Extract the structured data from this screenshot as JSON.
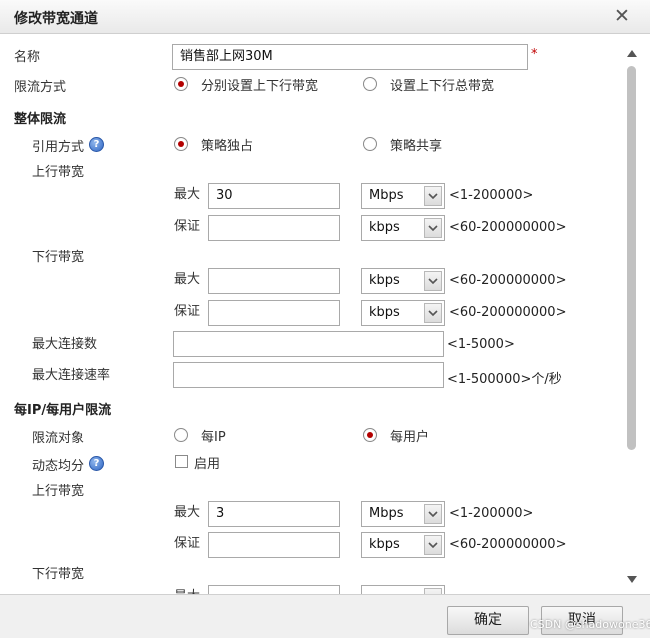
{
  "dialog": {
    "title": "修改带宽通道",
    "close_symbol": "✕"
  },
  "form": {
    "name_label": "名称",
    "name_value": "销售部上网30M",
    "required_mark": "*",
    "limit_mode_label": "限流方式",
    "limit_mode_options": [
      "分别设置上下行带宽",
      "设置上下行总带宽"
    ],
    "limit_mode_selected": 0
  },
  "overall": {
    "section_title": "整体限流",
    "ref_mode_label": "引用方式",
    "help_symbol": "?",
    "ref_mode_options": [
      "策略独占",
      "策略共享"
    ],
    "ref_mode_selected": 0,
    "up_label": "上行带宽",
    "max_label": "最大",
    "guarantee_label": "保证",
    "up_max_value": "30",
    "up_max_unit": "Mbps",
    "up_max_range": "<1-200000>",
    "up_guarantee_value": "",
    "up_guarantee_unit": "kbps",
    "up_guarantee_range": "<60-200000000>",
    "down_label": "下行带宽",
    "down_max_value": "",
    "down_max_unit": "kbps",
    "down_max_range": "<60-200000000>",
    "down_guarantee_value": "",
    "down_guarantee_unit": "kbps",
    "down_guarantee_range": "<60-200000000>",
    "max_conn_label": "最大连接数",
    "max_conn_value": "",
    "max_conn_range": "<1-5000>",
    "max_conn_rate_label": "最大连接速率",
    "max_conn_rate_value": "",
    "max_conn_rate_range": "<1-500000>个/秒"
  },
  "per_user": {
    "section_title": "每IP/每用户限流",
    "target_label": "限流对象",
    "target_options": [
      "每IP",
      "每用户"
    ],
    "target_selected": 1,
    "dynamic_label": "动态均分",
    "help_symbol": "?",
    "enable_label": "启用",
    "enable_checked": false,
    "up_label": "上行带宽",
    "max_label": "最大",
    "guarantee_label": "保证",
    "up_max_value": "3",
    "up_max_unit": "Mbps",
    "up_max_range": "<1-200000>",
    "up_guarantee_value": "",
    "up_guarantee_unit": "kbps",
    "up_guarantee_range": "<60-200000000>",
    "down_label": "下行带宽",
    "down_max_label_partial": "最大"
  },
  "footer": {
    "ok_label": "确定",
    "cancel_label": "取消"
  },
  "watermark": "CSDN @shadowone360",
  "icons": [
    "close-icon",
    "help-icon",
    "chevron-down-icon",
    "scroll-up-icon",
    "scroll-down-icon"
  ],
  "colors": {
    "radio_selected": "#b30000",
    "help_icon": "#2f66c4",
    "required": "#c00000"
  }
}
